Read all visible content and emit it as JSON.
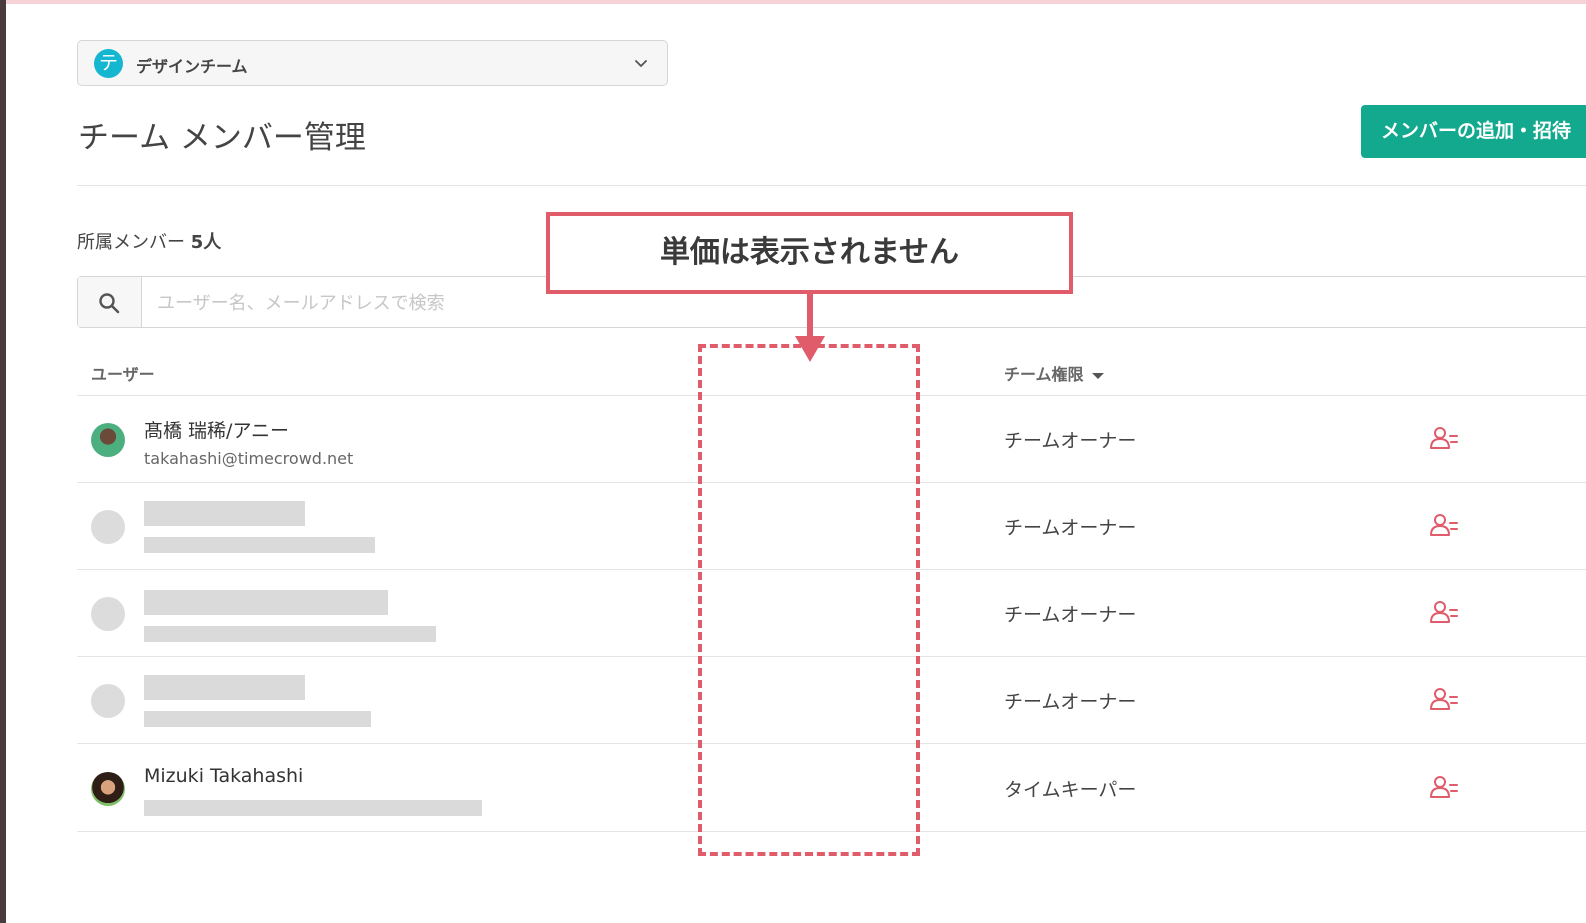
{
  "team_selector": {
    "avatar_char": "テ",
    "name": "デザインチーム"
  },
  "page": {
    "title": "チーム メンバー管理",
    "add_member_label": "メンバーの追加・招待"
  },
  "members_summary": {
    "label": "所属メンバー",
    "count": "5人"
  },
  "search": {
    "placeholder": "ユーザー名、メールアドレスで検索"
  },
  "table": {
    "header_user": "ユーザー",
    "header_role": "チーム権限",
    "rows": [
      {
        "name": "髙橋 瑞稀/アニー",
        "email": "takahashi@timecrowd.net",
        "role": "チームオーナー"
      },
      {
        "name": "",
        "email": "",
        "role": "チームオーナー"
      },
      {
        "name": "",
        "email": "",
        "role": "チームオーナー"
      },
      {
        "name": "",
        "email": "",
        "role": "チームオーナー"
      },
      {
        "name": "Mizuki Takahashi",
        "email": "",
        "role": "タイムキーパー"
      }
    ]
  },
  "annotation": {
    "callout_text": "単価は表示されません",
    "color": "#e05c6a"
  },
  "colors": {
    "accent": "#12a98e",
    "team_avatar": "#15b6d0",
    "danger": "#e05c6a"
  }
}
